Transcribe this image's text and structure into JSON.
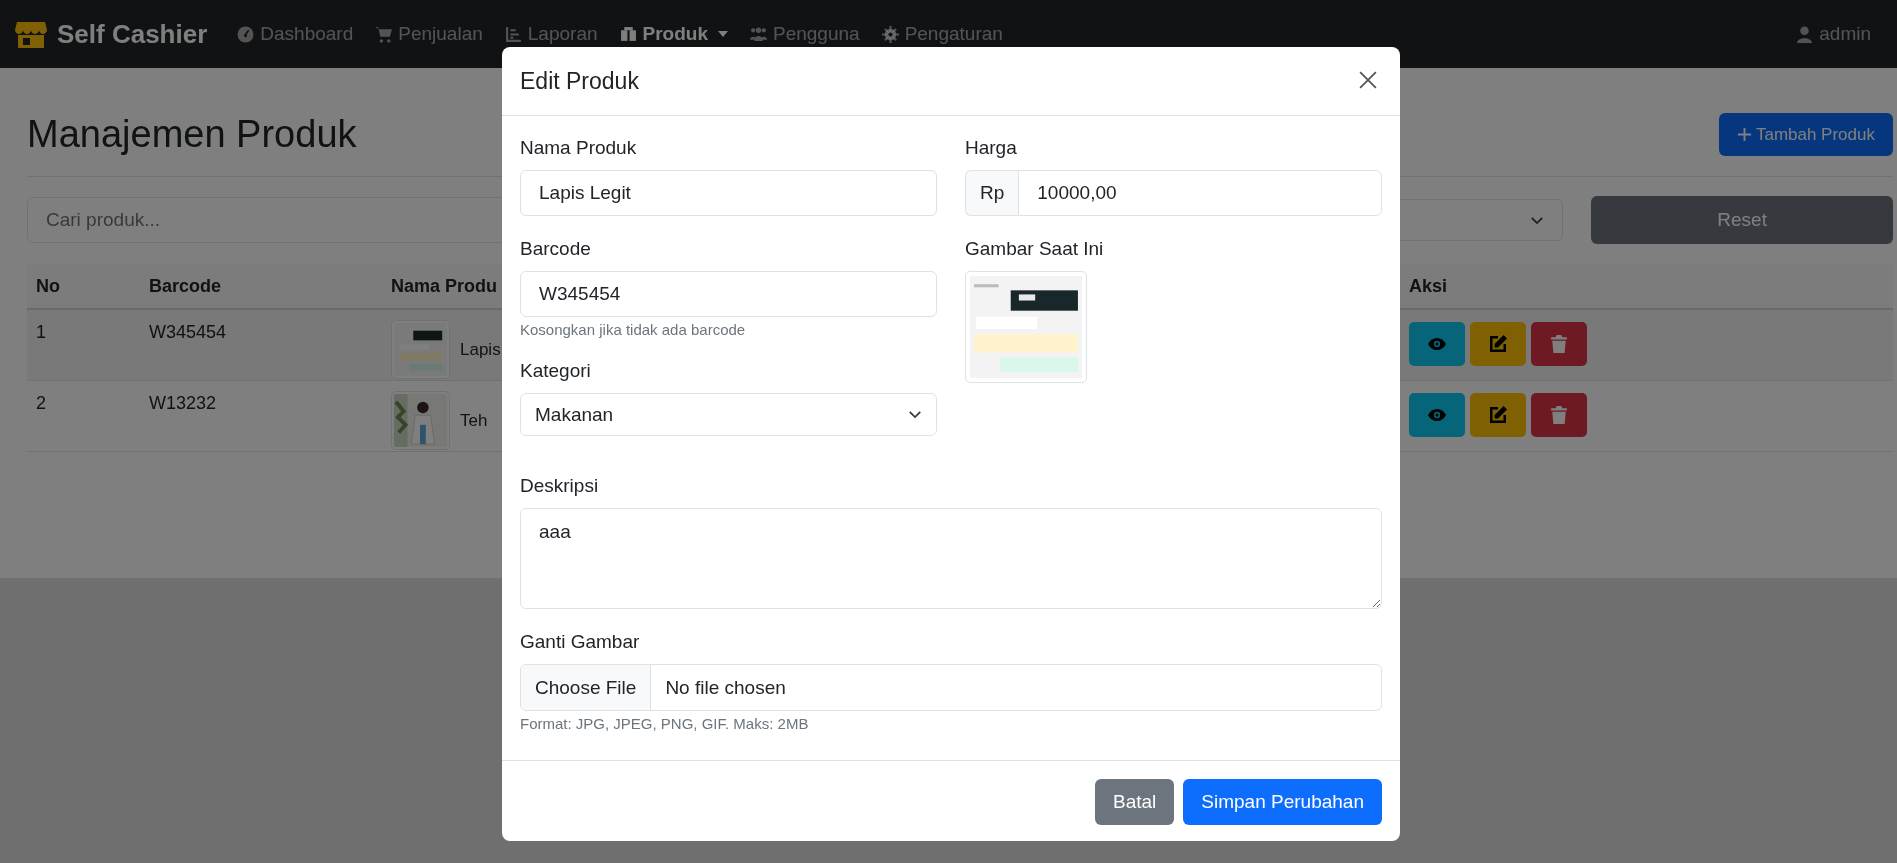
{
  "navbar": {
    "brand": "Self Cashier",
    "items": [
      {
        "label": "Dashboard",
        "selected": false,
        "dropdown": false
      },
      {
        "label": "Penjualan",
        "selected": false,
        "dropdown": false
      },
      {
        "label": "Laporan",
        "selected": false,
        "dropdown": false
      },
      {
        "label": "Produk",
        "selected": true,
        "dropdown": true
      },
      {
        "label": "Pengguna",
        "selected": false,
        "dropdown": false
      },
      {
        "label": "Pengaturan",
        "selected": false,
        "dropdown": false
      }
    ],
    "user": "admin"
  },
  "page": {
    "title": "Manajemen Produk",
    "add_button": "Tambah Produk",
    "search": {
      "placeholder": "Cari produk..."
    },
    "reset_button": "Reset"
  },
  "table": {
    "columns": [
      "No",
      "Barcode",
      "Nama Produ",
      "Aksi"
    ],
    "rows": [
      {
        "no": "1",
        "barcode": "W345454",
        "name": "Lapis"
      },
      {
        "no": "2",
        "barcode": "W13232",
        "name": "Teh"
      }
    ]
  },
  "modal": {
    "title": "Edit Produk",
    "name": {
      "label": "Nama Produk",
      "value": "Lapis Legit"
    },
    "price": {
      "label": "Harga",
      "prefix": "Rp",
      "value": "10000,00"
    },
    "barcode": {
      "label": "Barcode",
      "value": "W345454",
      "help": "Kosongkan jika tidak ada barcode"
    },
    "current_image": {
      "label": "Gambar Saat Ini"
    },
    "category": {
      "label": "Kategori",
      "value": "Makanan"
    },
    "description": {
      "label": "Deskripsi",
      "value": "aaa"
    },
    "file": {
      "label": "Ganti Gambar",
      "button": "Choose File",
      "status": "No file chosen",
      "help": "Format: JPG, JPEG, PNG, GIF. Maks: 2MB"
    },
    "buttons": {
      "cancel": "Batal",
      "save": "Simpan Perubahan"
    }
  }
}
